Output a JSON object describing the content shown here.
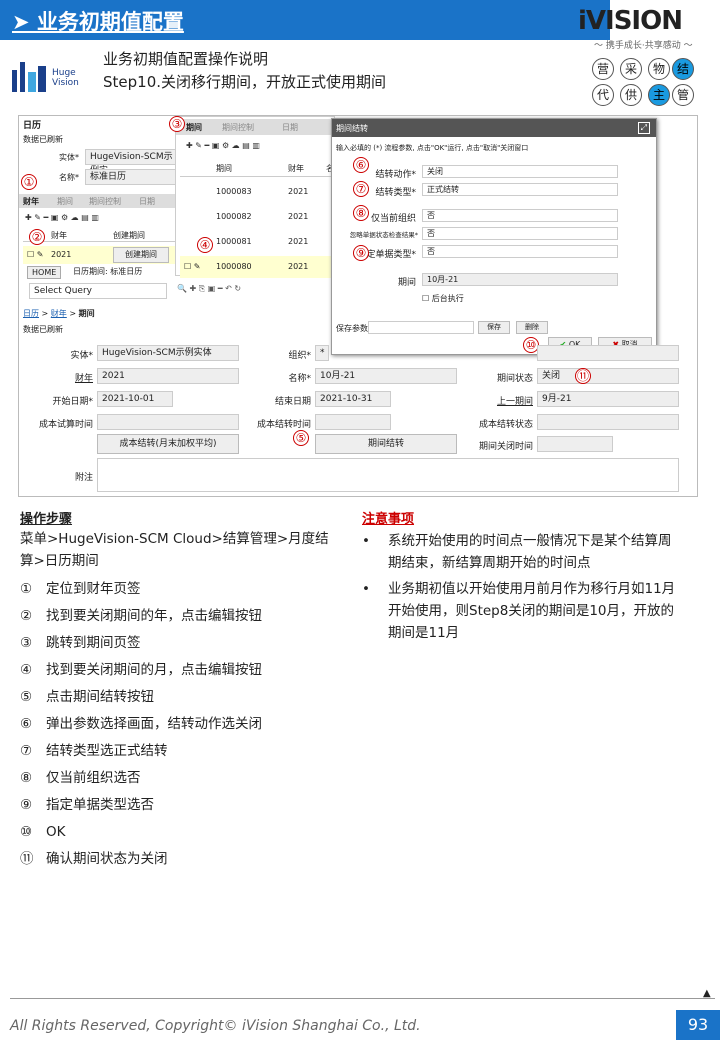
{
  "header": {
    "title": "➤ 业务初期值配置"
  },
  "logo": {
    "brand": "iVISION",
    "slogan": "～ 携手成长·共享感动 ～",
    "hv_name": "Huge Vision"
  },
  "intro": {
    "line1": "业务初期值配置操作说明",
    "line2": "Step10.关闭移行期间，开放正式使用期间"
  },
  "grid": [
    "营",
    "采",
    "物",
    "结",
    "代",
    "供",
    "主",
    "管"
  ],
  "screen": {
    "left_top": {
      "title": "日历",
      "status": "数据已刷新",
      "entity_label": "实体*",
      "entity": "HugeVision-SCM示例实",
      "name_label": "名称*",
      "name": "标准日历"
    },
    "year_tabs": [
      "财年",
      "期间",
      "期间控制",
      "日期"
    ],
    "year_cols": [
      "财年",
      "创建期间"
    ],
    "year_row": "2021",
    "create_btn": "创建期间",
    "home_tab": "HOME",
    "cal_tab": "日历期间: 标准日历",
    "select_query": "Select Query",
    "period_tabs": [
      "期间",
      "期间控制",
      "日期"
    ],
    "period_cols": [
      "期间",
      "财年",
      "名"
    ],
    "period_rows": [
      [
        "1000083",
        "2021",
        "1"
      ],
      [
        "1000082",
        "2021",
        "1"
      ],
      [
        "1000081",
        "2021",
        "1"
      ],
      [
        "1000080",
        "2021",
        "9,"
      ]
    ],
    "dialog": {
      "title": "期间结转",
      "hint": "输入必填的 (*) 流程参数, 点击\"OK\"运行, 点击\"取消\"关闭窗口",
      "f1_label": "结转动作*",
      "f1": "关闭",
      "f2_label": "结转类型*",
      "f2": "正式结转",
      "f3_label": "仅当前组织",
      "f3": "否",
      "f4_label": "忽略单据状态检查结果*",
      "f4": "否",
      "f5_label": "指定单据类型*",
      "f5": "否",
      "f6_label": "期间",
      "f6": "10月-21",
      "bg": "后台执行",
      "save_param": "保存参数",
      "save": "保存",
      "del": "删除",
      "ok": "OK",
      "cancel": "取消"
    },
    "bread": [
      "日历",
      ">",
      "财年",
      ">",
      "期间"
    ],
    "status2": "数据已刷新",
    "form": {
      "entity_l": "实体*",
      "entity": "HugeVision-SCM示例实体",
      "org_l": "组织*",
      "org": "*",
      "year_l": "财年",
      "year": "2021",
      "name_l": "名称*",
      "name": "10月-21",
      "state_l": "期间状态",
      "state": "关闭",
      "start_l": "开始日期*",
      "start": "2021-10-01",
      "end_l": "结束日期",
      "end": "2021-10-31",
      "prev_l": "上一期间",
      "prev": "9月-21",
      "trial_l": "成本试算时间",
      "close_l": "成本结转时间",
      "close_s_l": "成本结转状态",
      "btn1": "成本结转(月末加权平均)",
      "btn2": "期间结转",
      "pclose_l": "期间关闭时间",
      "memo_l": "附注"
    }
  },
  "steps": {
    "title": "操作步骤",
    "menu": "菜单>HugeVision-SCM Cloud>结算管理>月度结算>日历期间",
    "items": [
      [
        "①",
        "定位到财年页签"
      ],
      [
        "②",
        "找到要关闭期间的年，点击编辑按钮"
      ],
      [
        "③",
        "跳转到期间页签"
      ],
      [
        "④",
        "找到要关闭期间的月，点击编辑按钮"
      ],
      [
        "⑤",
        "点击期间结转按钮"
      ],
      [
        "⑥",
        "弹出参数选择画面，结转动作选关闭"
      ],
      [
        "⑦",
        "结转类型选正式结转"
      ],
      [
        "⑧",
        "仅当前组织选否"
      ],
      [
        "⑨",
        "指定单据类型选否"
      ],
      [
        "⑩",
        "OK"
      ],
      [
        "⑪",
        "确认期间状态为关闭"
      ]
    ]
  },
  "notes": {
    "title": "注意事项",
    "items": [
      "系统开始使用的时间点一般情况下是某个结算周期结束，新结算周期开始的时间点",
      "业务期初值以开始使用月前月作为移行月如11月开始使用，则Step8关闭的期间是10月，开放的期间是11月"
    ]
  },
  "footer": {
    "copyright": "All Rights Reserved, Copyright© iVision Shanghai Co., Ltd.",
    "page": "93"
  }
}
